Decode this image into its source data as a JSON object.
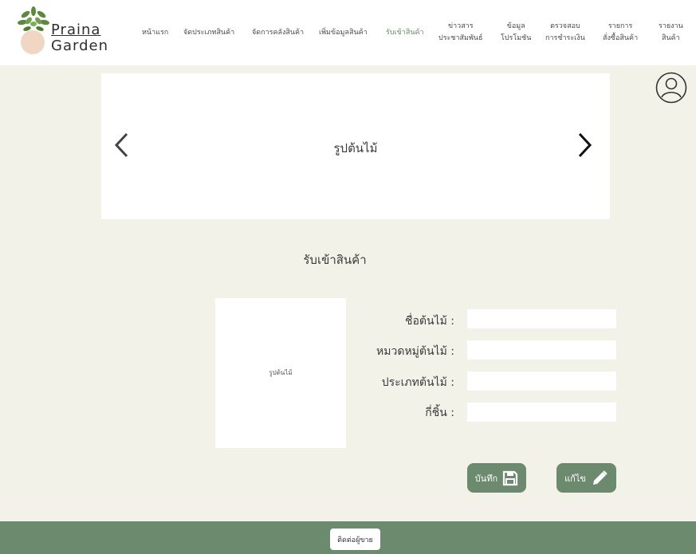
{
  "brand": {
    "line1": "Praina",
    "line2": "Garden"
  },
  "nav": {
    "home": "หน้าแรก",
    "manage_categories": "จัดประเภทสินค้า",
    "manage_stock": "จัดการคลังสินค้า",
    "add_product": "เพิ่มข้อมูลสินค้า",
    "receive_product": "รับเข้าสินค้า",
    "news_l1": "ข่าวสาร",
    "news_l2": "ประชาสัมพันธ์",
    "promo_l1": "ข้อมูล",
    "promo_l2": "โปรโมชัน",
    "payment_l1": "ตรวจสอบ",
    "payment_l2": "การชำระเงิน",
    "orders_l1": "รายการ",
    "orders_l2": "สั่งซื้อสินค้า",
    "report_l1": "รายงาน",
    "report_l2": "สินค้า"
  },
  "banner": {
    "caption": "รูปต้นไม้"
  },
  "page": {
    "title": "รับเข้าสินค้า"
  },
  "product_image": {
    "caption": "รูปต้นไม้"
  },
  "form": {
    "name_label": "ชื่อต้นไม้ :",
    "category_label": "หมวดหมู่ต้นไม้ :",
    "type_label": "ประเภทต้นไม้ :",
    "quantity_label": "กี่ชิ้น :",
    "name_value": "",
    "category_value": "",
    "type_value": "",
    "quantity_value": ""
  },
  "buttons": {
    "save": "บันทึก",
    "edit": "แก้ไข"
  },
  "footer": {
    "contact": "ติดต่อผู้ขาย"
  },
  "colors": {
    "accent": "#6C8A6D",
    "background": "#F3F2E8",
    "active_nav": "#6A8A6A"
  },
  "icons": [
    "plant-logo-icon",
    "user-profile-icon",
    "chevron-left-icon",
    "chevron-right-icon",
    "floppy-save-icon",
    "pencil-edit-icon"
  ]
}
